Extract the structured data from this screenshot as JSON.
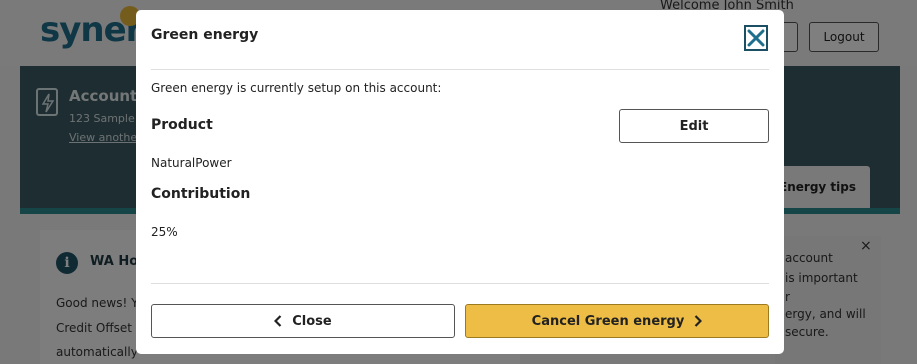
{
  "background": {
    "logo_text": "synerg",
    "welcome": "Welcome John Smith",
    "logout_label": "Logout",
    "account": {
      "title": "Account",
      "address": "123 Sample",
      "view_link": "View another"
    },
    "energy_tips_tab": "Energy tips",
    "info_card": {
      "title": "WA Ho",
      "lines": [
        "Good news! Y",
        "Credit Offset",
        "automatically"
      ]
    },
    "notice_card": {
      "close": "×",
      "lines": [
        "account",
        "is important",
        "r",
        "ergy, and will",
        "secure."
      ]
    }
  },
  "modal": {
    "title": "Green energy",
    "close_icon": "close-icon",
    "intro": "Green energy is currently setup on this account:",
    "product_label": "Product",
    "product_value": "NaturalPower",
    "contribution_label": "Contribution",
    "contribution_value": "25%",
    "edit_label": "Edit",
    "close_label": "Close",
    "cancel_label": "Cancel Green energy"
  },
  "colors": {
    "brand_teal": "#1e6f8c",
    "account_band": "#3c5a63",
    "cancel_button": "#eebd45",
    "close_border": "#1b4f63"
  }
}
